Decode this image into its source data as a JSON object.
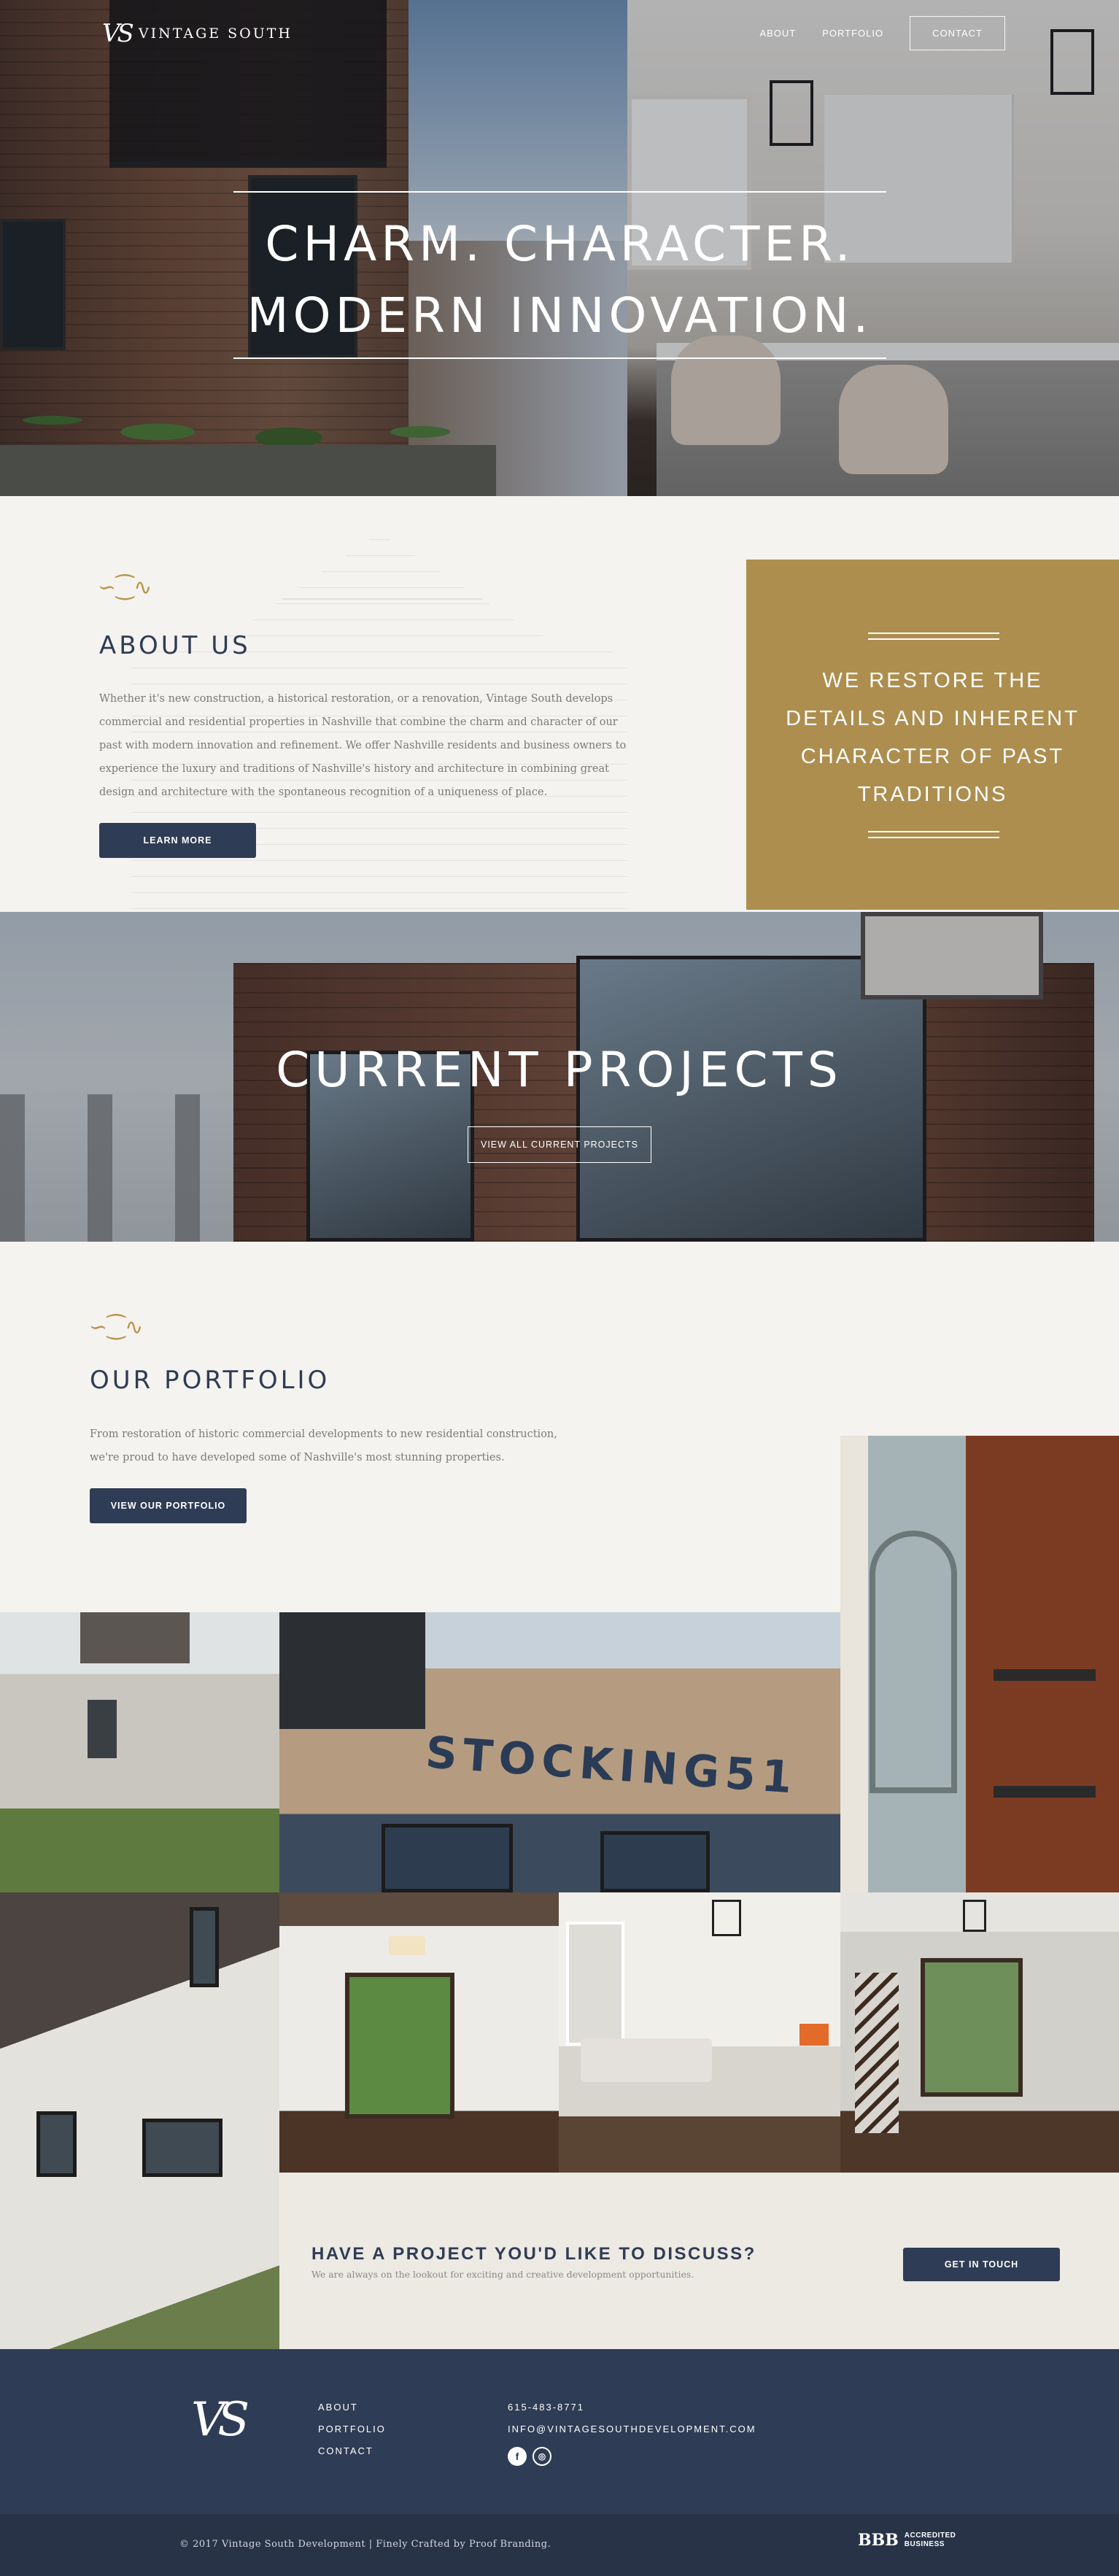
{
  "header": {
    "logo_mark": "VS",
    "logo_name": "Vintage South",
    "nav": [
      {
        "label": "About"
      },
      {
        "label": "Portfolio"
      },
      {
        "label": "Contact"
      }
    ]
  },
  "hero": {
    "line1": "CHARM. CHARACTER.",
    "line2": "MODERN INNOVATION."
  },
  "about": {
    "title": "ABOUT US",
    "body": "Whether it's new construction, a historical restoration, or a renovation, Vintage South develops commercial and residential properties in Nashville that combine the charm and character of our past with modern innovation and refinement. We offer Nashville residents and business owners to experience the luxury and traditions of Nashville's history and architecture in combining great design and architecture with the spontaneous recognition of a uniqueness of place.",
    "button": "Learn More"
  },
  "restore": {
    "text": "WE RESTORE THE DETAILS AND INHERENT CHARACTER OF PAST TRADITIONS"
  },
  "projects": {
    "title": "CURRENT PROJECTS",
    "button": "View All Current Projects"
  },
  "portfolio": {
    "title": "OUR PORTFOLIO",
    "body": "From restoration of historic commercial developments to new residential construction, we're proud to have developed some of Nashville's most stunning properties.",
    "button": "View Our Portfolio",
    "stocking_sign": "STOCKING51"
  },
  "cta": {
    "title": "HAVE A PROJECT YOU'D LIKE TO DISCUSS?",
    "subtitle": "We are always on the lookout for exciting and creative development opportunities.",
    "button": "Get In Touch"
  },
  "footer": {
    "logo_mark": "VS",
    "links": [
      {
        "label": "About"
      },
      {
        "label": "Portfolio"
      },
      {
        "label": "Contact"
      }
    ],
    "phone": "615-483-8771",
    "email": "INFO@VINTAGESOUTHDEVELOPMENT.COM",
    "social": [
      {
        "icon": "facebook-icon",
        "glyph": "f"
      },
      {
        "icon": "instagram-icon",
        "glyph": "◎"
      }
    ],
    "copyright": "© 2017 Vintage South Development | Finely Crafted by Proof Branding.",
    "bbb_seal": "BBB",
    "bbb_line1": "ACCREDITED",
    "bbb_line2": "BUSINESS"
  },
  "colors": {
    "navy": "#2f3c55",
    "gold": "#ad8e4f",
    "cream": "#f5f3ef"
  }
}
